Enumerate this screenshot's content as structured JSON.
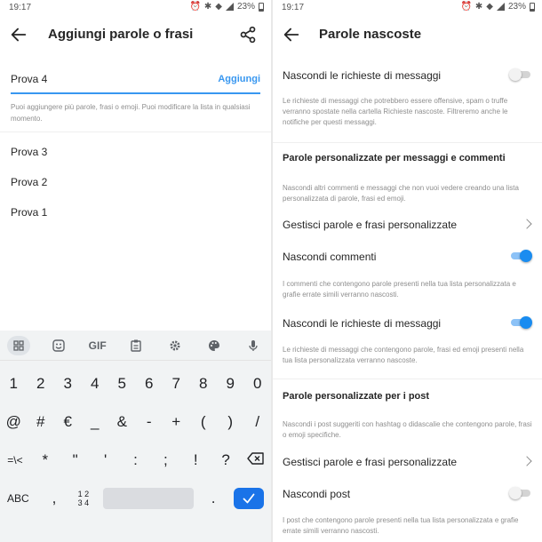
{
  "left": {
    "status": {
      "time": "19:17",
      "battery": "23%"
    },
    "title": "Aggiungi parole o frasi",
    "input": {
      "value": "Prova 4",
      "add_label": "Aggiungi"
    },
    "hint": "Puoi aggiungere più parole, frasi o emoji. Puoi modificare la lista in qualsiasi momento.",
    "words": [
      "Prova 3",
      "Prova 2",
      "Prova 1"
    ],
    "keyboard": {
      "toolbar": [
        "apps-icon",
        "sticker-icon",
        "gif-label",
        "clipboard-icon",
        "gear-icon",
        "palette-icon",
        "mic-icon"
      ],
      "gif_label": "GIF",
      "row1": [
        "1",
        "2",
        "3",
        "4",
        "5",
        "6",
        "7",
        "8",
        "9",
        "0"
      ],
      "row2": [
        "@",
        "#",
        "€",
        "_",
        "&",
        "-",
        "+",
        "(",
        ")",
        "/"
      ],
      "row3": [
        "=\\<",
        "*",
        "\"",
        "'",
        ":",
        ";",
        "!",
        "?"
      ],
      "abc": "ABC",
      "comma": ",",
      "numpad_top": "1 2",
      "numpad_bottom": "3 4",
      "period": "."
    }
  },
  "right": {
    "status": {
      "time": "19:17",
      "battery": "23%"
    },
    "title": "Parole nascoste",
    "items": {
      "hide_requests_1": {
        "label": "Nascondi le richieste di messaggi",
        "on": false,
        "desc": "Le richieste di messaggi che potrebbero essere offensive, spam o truffe verranno spostate nella cartella Richieste nascoste. Filtreremo anche le notifiche per questi messaggi."
      },
      "section_messages": {
        "title": "Parole personalizzate per messaggi e commenti",
        "desc": "Nascondi altri commenti e messaggi che non vuoi vedere creando una lista personalizzata di parole, frasi ed emoji."
      },
      "manage_1": {
        "label": "Gestisci parole e frasi personalizzate"
      },
      "hide_comments": {
        "label": "Nascondi commenti",
        "on": true,
        "desc": "I commenti che contengono parole presenti nella tua lista personalizzata e grafie errate simili verranno nascosti."
      },
      "hide_requests_2": {
        "label": "Nascondi le richieste di messaggi",
        "on": true,
        "desc": "Le richieste di messaggi che contengono parole, frasi ed emoji presenti nella tua lista personalizzata verranno nascoste."
      },
      "section_posts": {
        "title": "Parole personalizzate per i post",
        "desc": "Nascondi i post suggeriti con hashtag o didascalie che contengono parole, frasi o emoji specifiche."
      },
      "manage_2": {
        "label": "Gestisci parole e frasi personalizzate"
      },
      "hide_posts": {
        "label": "Nascondi post",
        "on": false,
        "desc": "I post che contengono parole presenti nella tua lista personalizzata e grafie errate simili verranno nascosti."
      }
    }
  },
  "colors": {
    "accent": "#3897f0",
    "toggle_on": "#1a8cf0",
    "keyboard_bg": "#f1f3f4",
    "enter_key": "#1a73e8"
  }
}
